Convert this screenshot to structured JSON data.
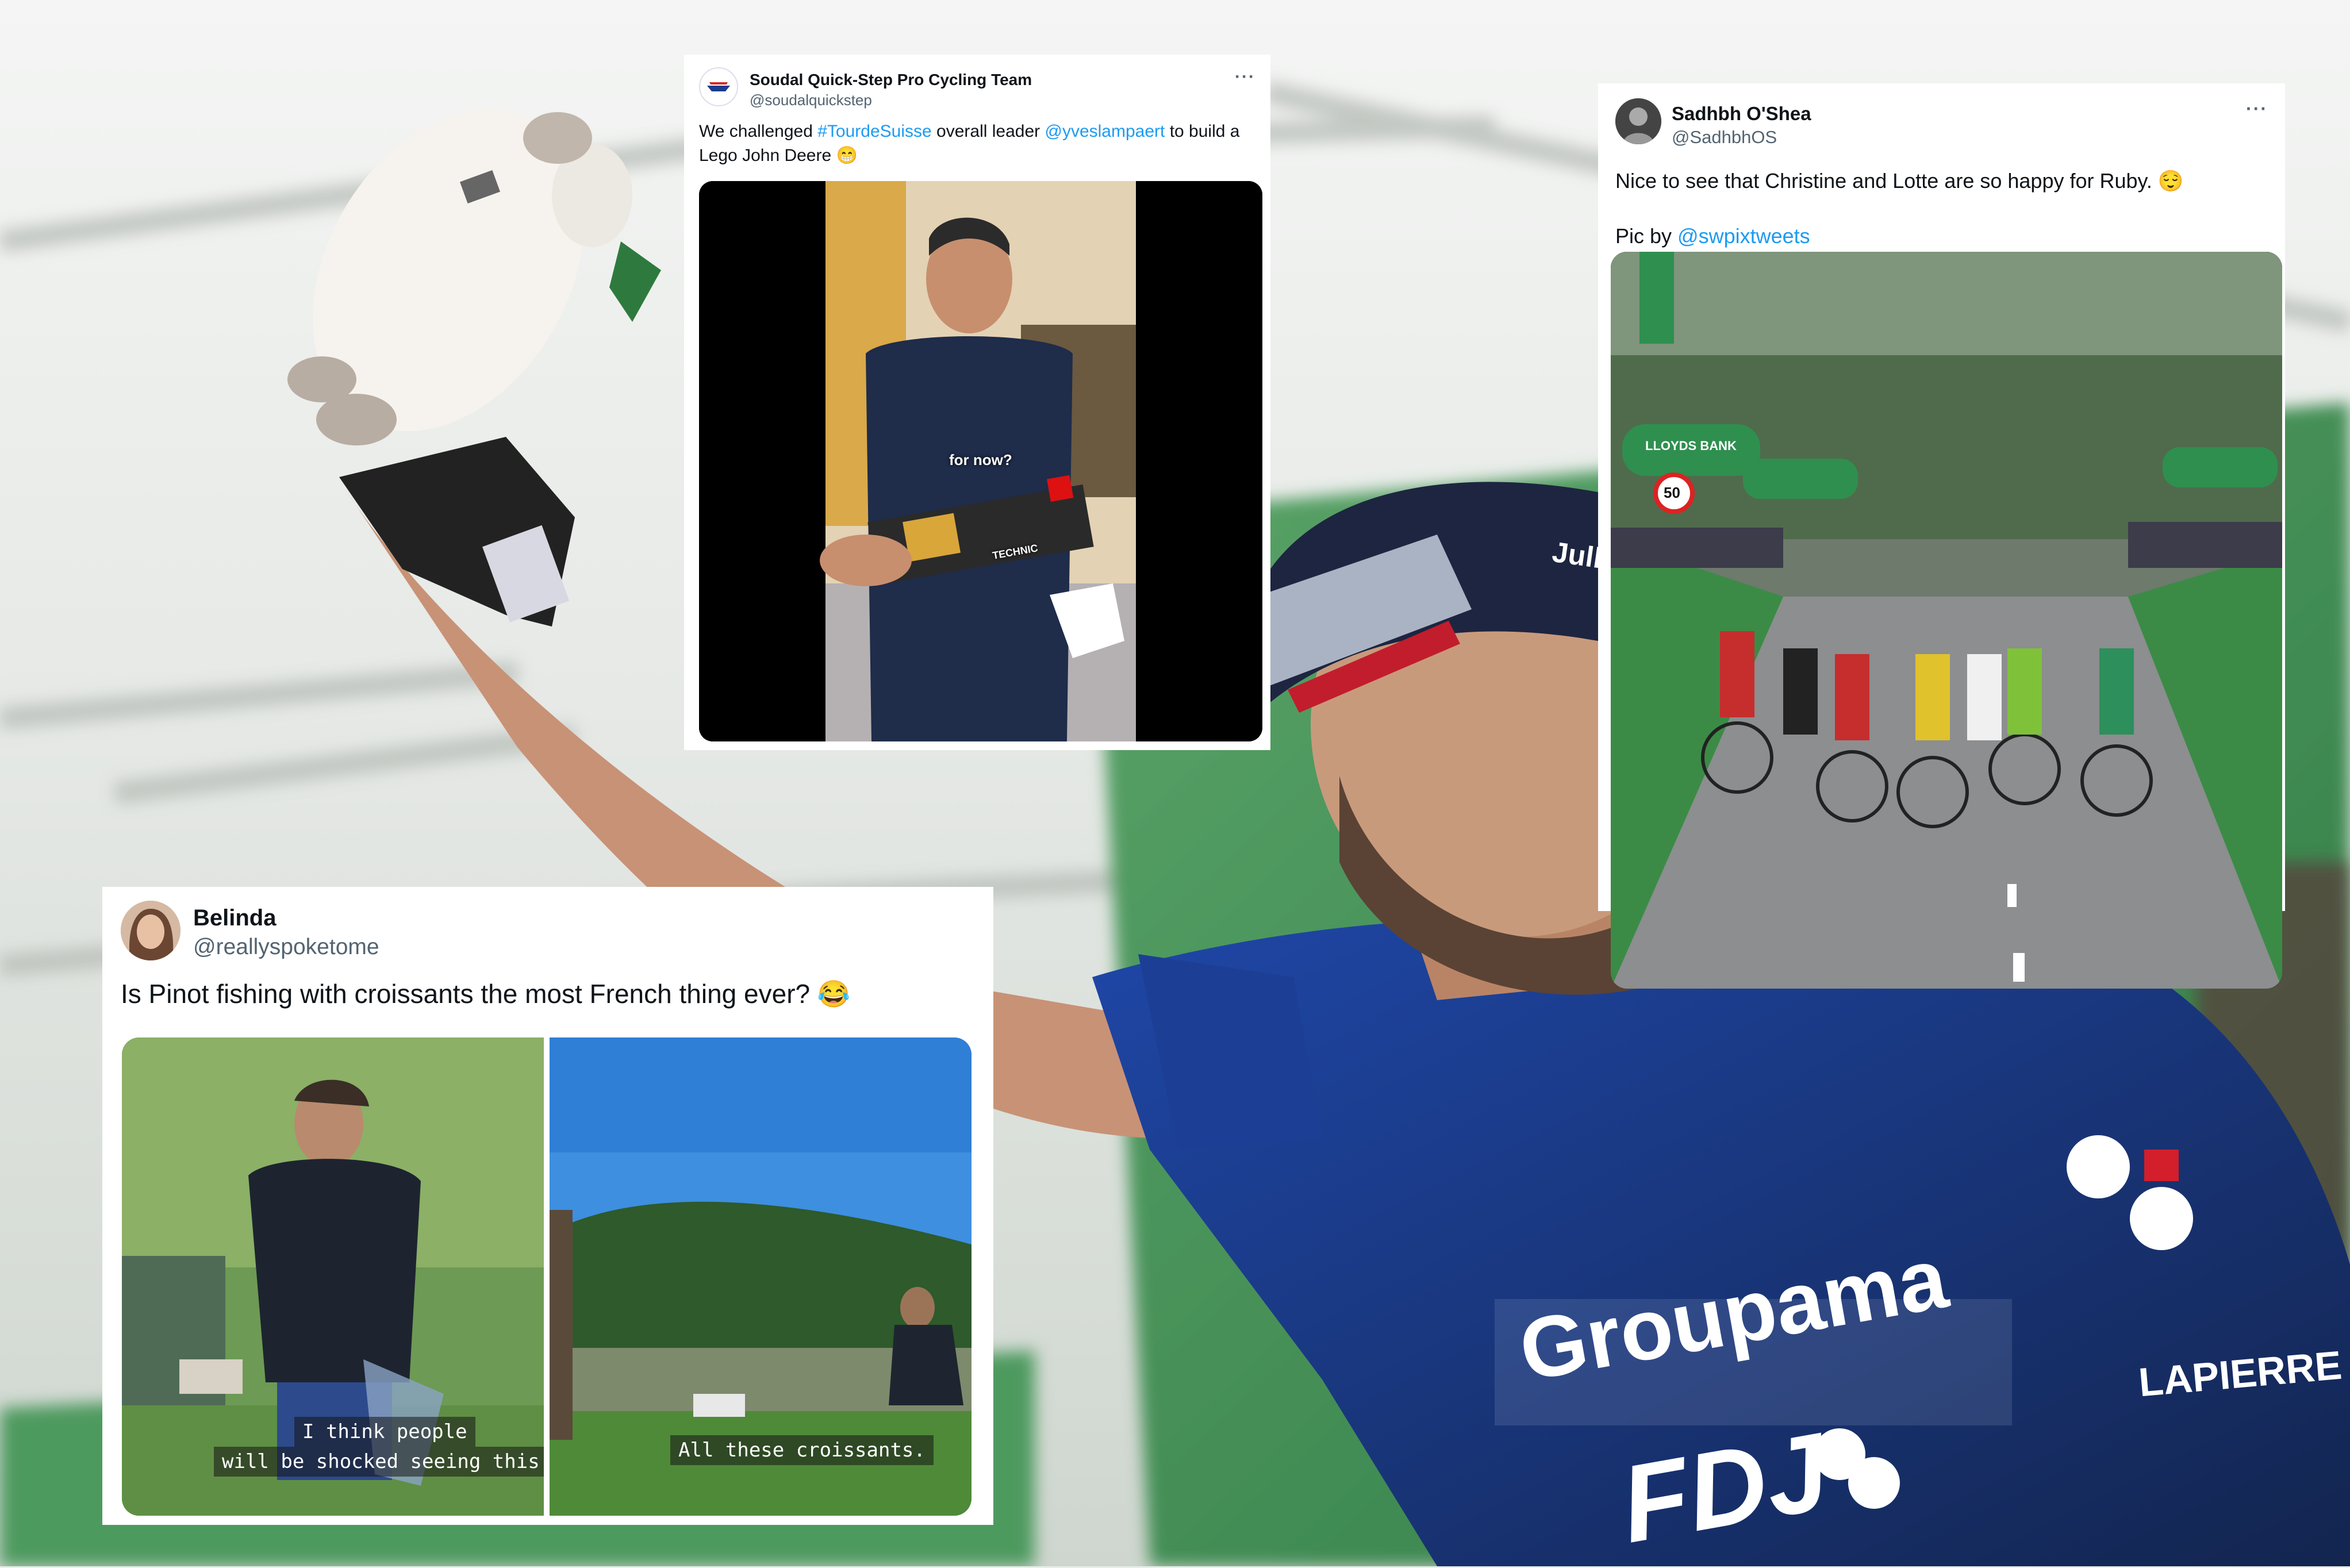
{
  "colors": {
    "link": "#1d9bf0",
    "handle": "#536471",
    "jersey_blue": "#1d3f8f",
    "jersey_navy": "#152448",
    "green_bg": "#3f8a4a"
  },
  "tweets": [
    {
      "name": "Soudal Quick-Step Pro Cycling Team",
      "handle": "@soudalquickstep",
      "more": "···",
      "text_before": "We challenged ",
      "hashtag": "#TourdeSuisse",
      "text_middle": " overall leader ",
      "mention": "@yveslampaert",
      "text_after": " to build a Lego John Deere 😁",
      "video_caption": "for now?",
      "box_label": "TECHNIC"
    },
    {
      "name": "Sadhbh O'Shea",
      "handle": "@SadhbhOS",
      "more": "···",
      "text": "Nice to see that Christine and Lotte are so happy for Ruby. 😌",
      "credit_prefix": "Pic by ",
      "credit_mention": "@swpixtweets",
      "banner_text": "LLOYDS BANK",
      "sign_number": "50"
    },
    {
      "name": "Belinda",
      "handle": "@reallyspoketome",
      "text": "Is Pinot fishing with croissants the most French thing ever? 😂",
      "caption_left_1": "I think people",
      "caption_left_2": "will be shocked seeing this.",
      "caption_right": "All these croissants."
    }
  ],
  "jersey": {
    "brand_1": "Groupama",
    "brand_2": "FDJ",
    "sponsor": "LAPIERRE",
    "helmet": "Julbo"
  }
}
